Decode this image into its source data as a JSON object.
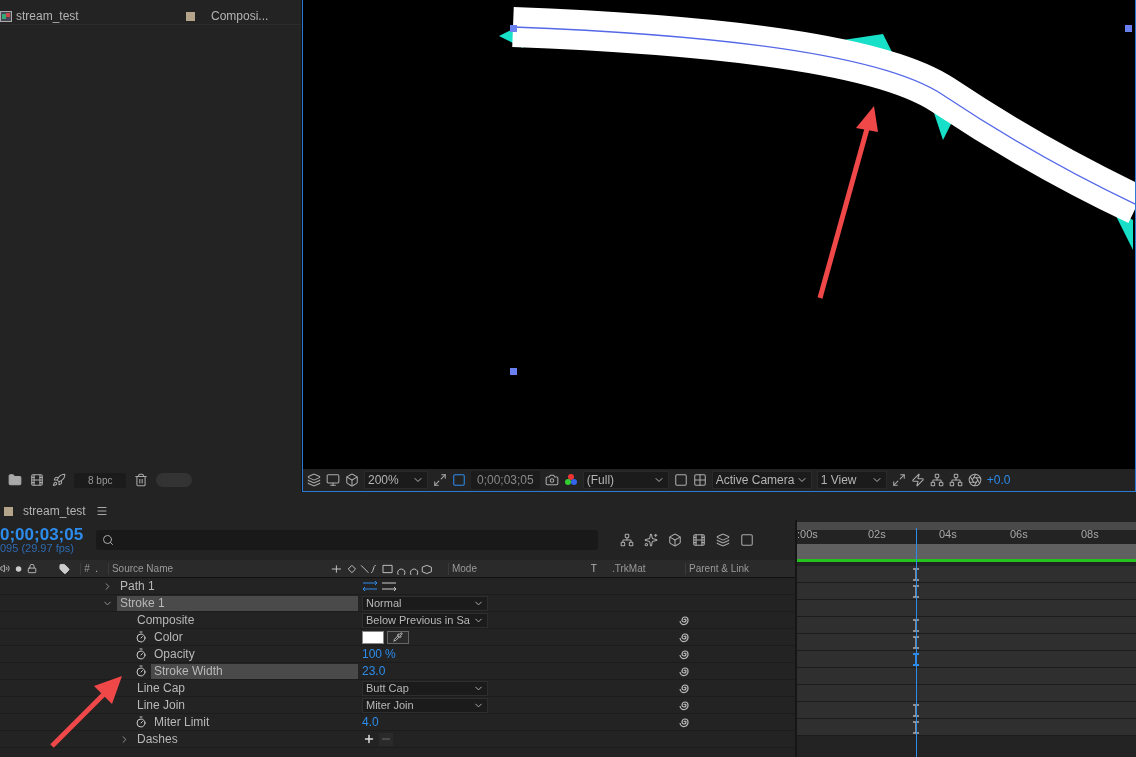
{
  "project": {
    "items": [
      {
        "name": "stream_test",
        "color": "#b4a58a",
        "type": "Composi..."
      }
    ],
    "bpc": "8 bpc"
  },
  "viewer": {
    "zoom": "200%",
    "timecode": "0;00;03;05",
    "resolution": "(Full)",
    "camera": "Active Camera",
    "views": "1 View",
    "exposure": "+0.0"
  },
  "timeline": {
    "tab": {
      "title": "stream_test",
      "color": "#b4a58a"
    },
    "timecode": "0;00;03;05",
    "fps": "095 (29.97 fps)",
    "columns": {
      "number": "#",
      "dot": ".",
      "source_name": "Source Name",
      "mode": "Mode",
      "t": "T",
      "trkmat": ".TrkMat",
      "parent": "Parent & Link"
    },
    "ruler": [
      ":00s",
      "02s",
      "04s",
      "06s",
      "08s"
    ],
    "playhead": {
      "level": 0.335
    },
    "rows": [
      {
        "name": "Path 1",
        "expanded": false,
        "selected": false,
        "stopwatch": false,
        "value": {
          "kind": "path-buttons"
        },
        "link": false,
        "keyframe": true
      },
      {
        "name": "Stroke 1",
        "expanded": true,
        "selected": false,
        "highlighted": true,
        "stopwatch": false,
        "value": {
          "kind": "dropdown",
          "text": "Normal"
        },
        "link": false,
        "keyframe": true,
        "children": [
          {
            "name": "Composite",
            "selected": false,
            "stopwatch": false,
            "value": {
              "kind": "dropdown",
              "text": "Below Previous in Sa"
            },
            "link": true,
            "keyframe": false
          },
          {
            "name": "Color",
            "selected": false,
            "stopwatch": true,
            "value": {
              "kind": "color",
              "color": "#ffffff"
            },
            "link": true,
            "keyframe": true
          },
          {
            "name": "Opacity",
            "selected": false,
            "stopwatch": true,
            "value": {
              "kind": "number",
              "text": "100",
              "unit": "%"
            },
            "link": true,
            "keyframe": true
          },
          {
            "name": "Stroke Width",
            "selected": true,
            "stopwatch": true,
            "value": {
              "kind": "number",
              "text": "23.0"
            },
            "link": true,
            "keyframe": true
          },
          {
            "name": "Line Cap",
            "selected": false,
            "stopwatch": false,
            "value": {
              "kind": "dropdown",
              "text": "Butt Cap"
            },
            "link": true,
            "keyframe": false
          },
          {
            "name": "Line Join",
            "selected": false,
            "stopwatch": false,
            "value": {
              "kind": "dropdown",
              "text": "Miter Join"
            },
            "link": true,
            "keyframe": false
          },
          {
            "name": "Miter Limit",
            "selected": false,
            "stopwatch": true,
            "value": {
              "kind": "number",
              "text": "4.0"
            },
            "link": true,
            "keyframe": true
          },
          {
            "name": "Dashes",
            "expanded": false,
            "selected": false,
            "stopwatch": false,
            "value": {
              "kind": "add-remove"
            },
            "link": false,
            "keyframe": true
          }
        ]
      }
    ]
  }
}
